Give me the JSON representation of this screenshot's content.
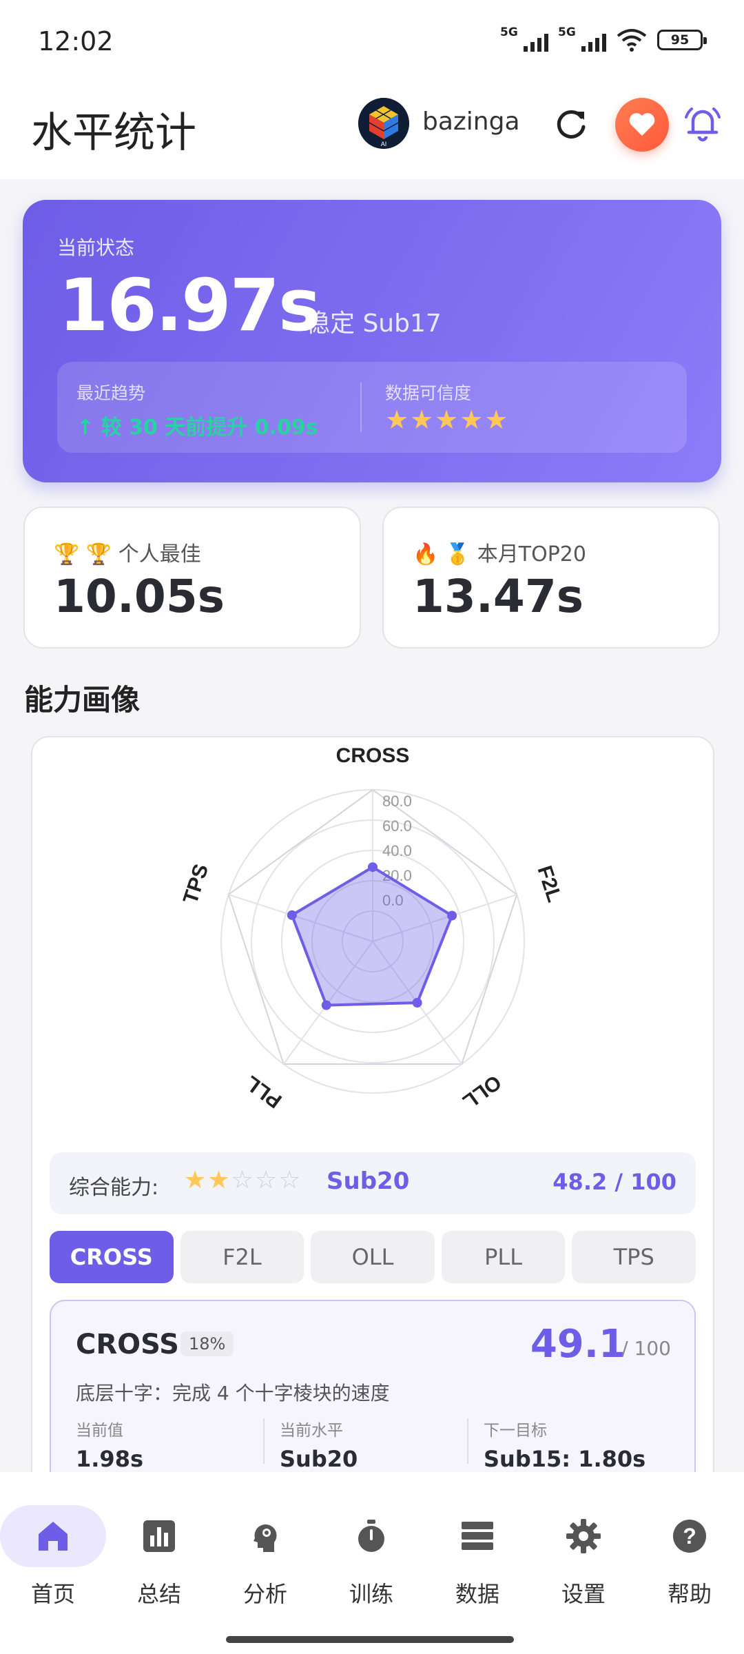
{
  "status_bar": {
    "time": "12:02",
    "signal1": "5G",
    "signal2": "5G",
    "battery": "95"
  },
  "header": {
    "title": "水平统计",
    "username": "bazinga",
    "avatar_text": "AI"
  },
  "hero": {
    "label": "当前状态",
    "value": "16.97s",
    "subtitle": "稳定 Sub17",
    "trend_label": "最近趋势",
    "trend_value": "↑ 较 30 天前提升 0.09s",
    "reliability_label": "数据可信度",
    "reliability_stars": "★★★★★"
  },
  "cards": {
    "best": {
      "label": "🏆 个人最佳",
      "value": "10.05s"
    },
    "top20": {
      "label": "🥇 本月TOP20",
      "value": "13.47s"
    }
  },
  "section": {
    "title": "能力画像"
  },
  "chart_data": {
    "type": "radar",
    "categories": [
      "CROSS",
      "F2L",
      "OLL",
      "PLL",
      "TPS"
    ],
    "ticks": [
      "80.0",
      "60.0",
      "40.0",
      "20.0",
      "0.0"
    ],
    "rlim": [
      0,
      100
    ],
    "series": [
      {
        "values": [
          49,
          55,
          50,
          52,
          56
        ]
      }
    ]
  },
  "overall": {
    "label": "综合能力:",
    "stars_on": "★★",
    "stars_off": "☆☆☆",
    "level": "Sub20",
    "score": "48.2 / 100"
  },
  "tabs": [
    "CROSS",
    "F2L",
    "OLL",
    "PLL",
    "TPS"
  ],
  "detail": {
    "name": "CROSS",
    "weight": "18%",
    "score": "49.1",
    "max": "/ 100",
    "description": "底层十字：完成 4 个十字棱块的速度",
    "current_label": "当前值",
    "current_value": "1.98s",
    "level_label": "当前水平",
    "level_value": "Sub20",
    "target_label": "下一目标",
    "target_value": "Sub15: 1.80s"
  },
  "nav": [
    "首页",
    "总结",
    "分析",
    "训练",
    "数据",
    "设置",
    "帮助"
  ],
  "colors": {
    "accent": "#6e5de6",
    "heart": "#ff5a3c",
    "trend": "#27d3a3",
    "star": "#ffc857"
  }
}
